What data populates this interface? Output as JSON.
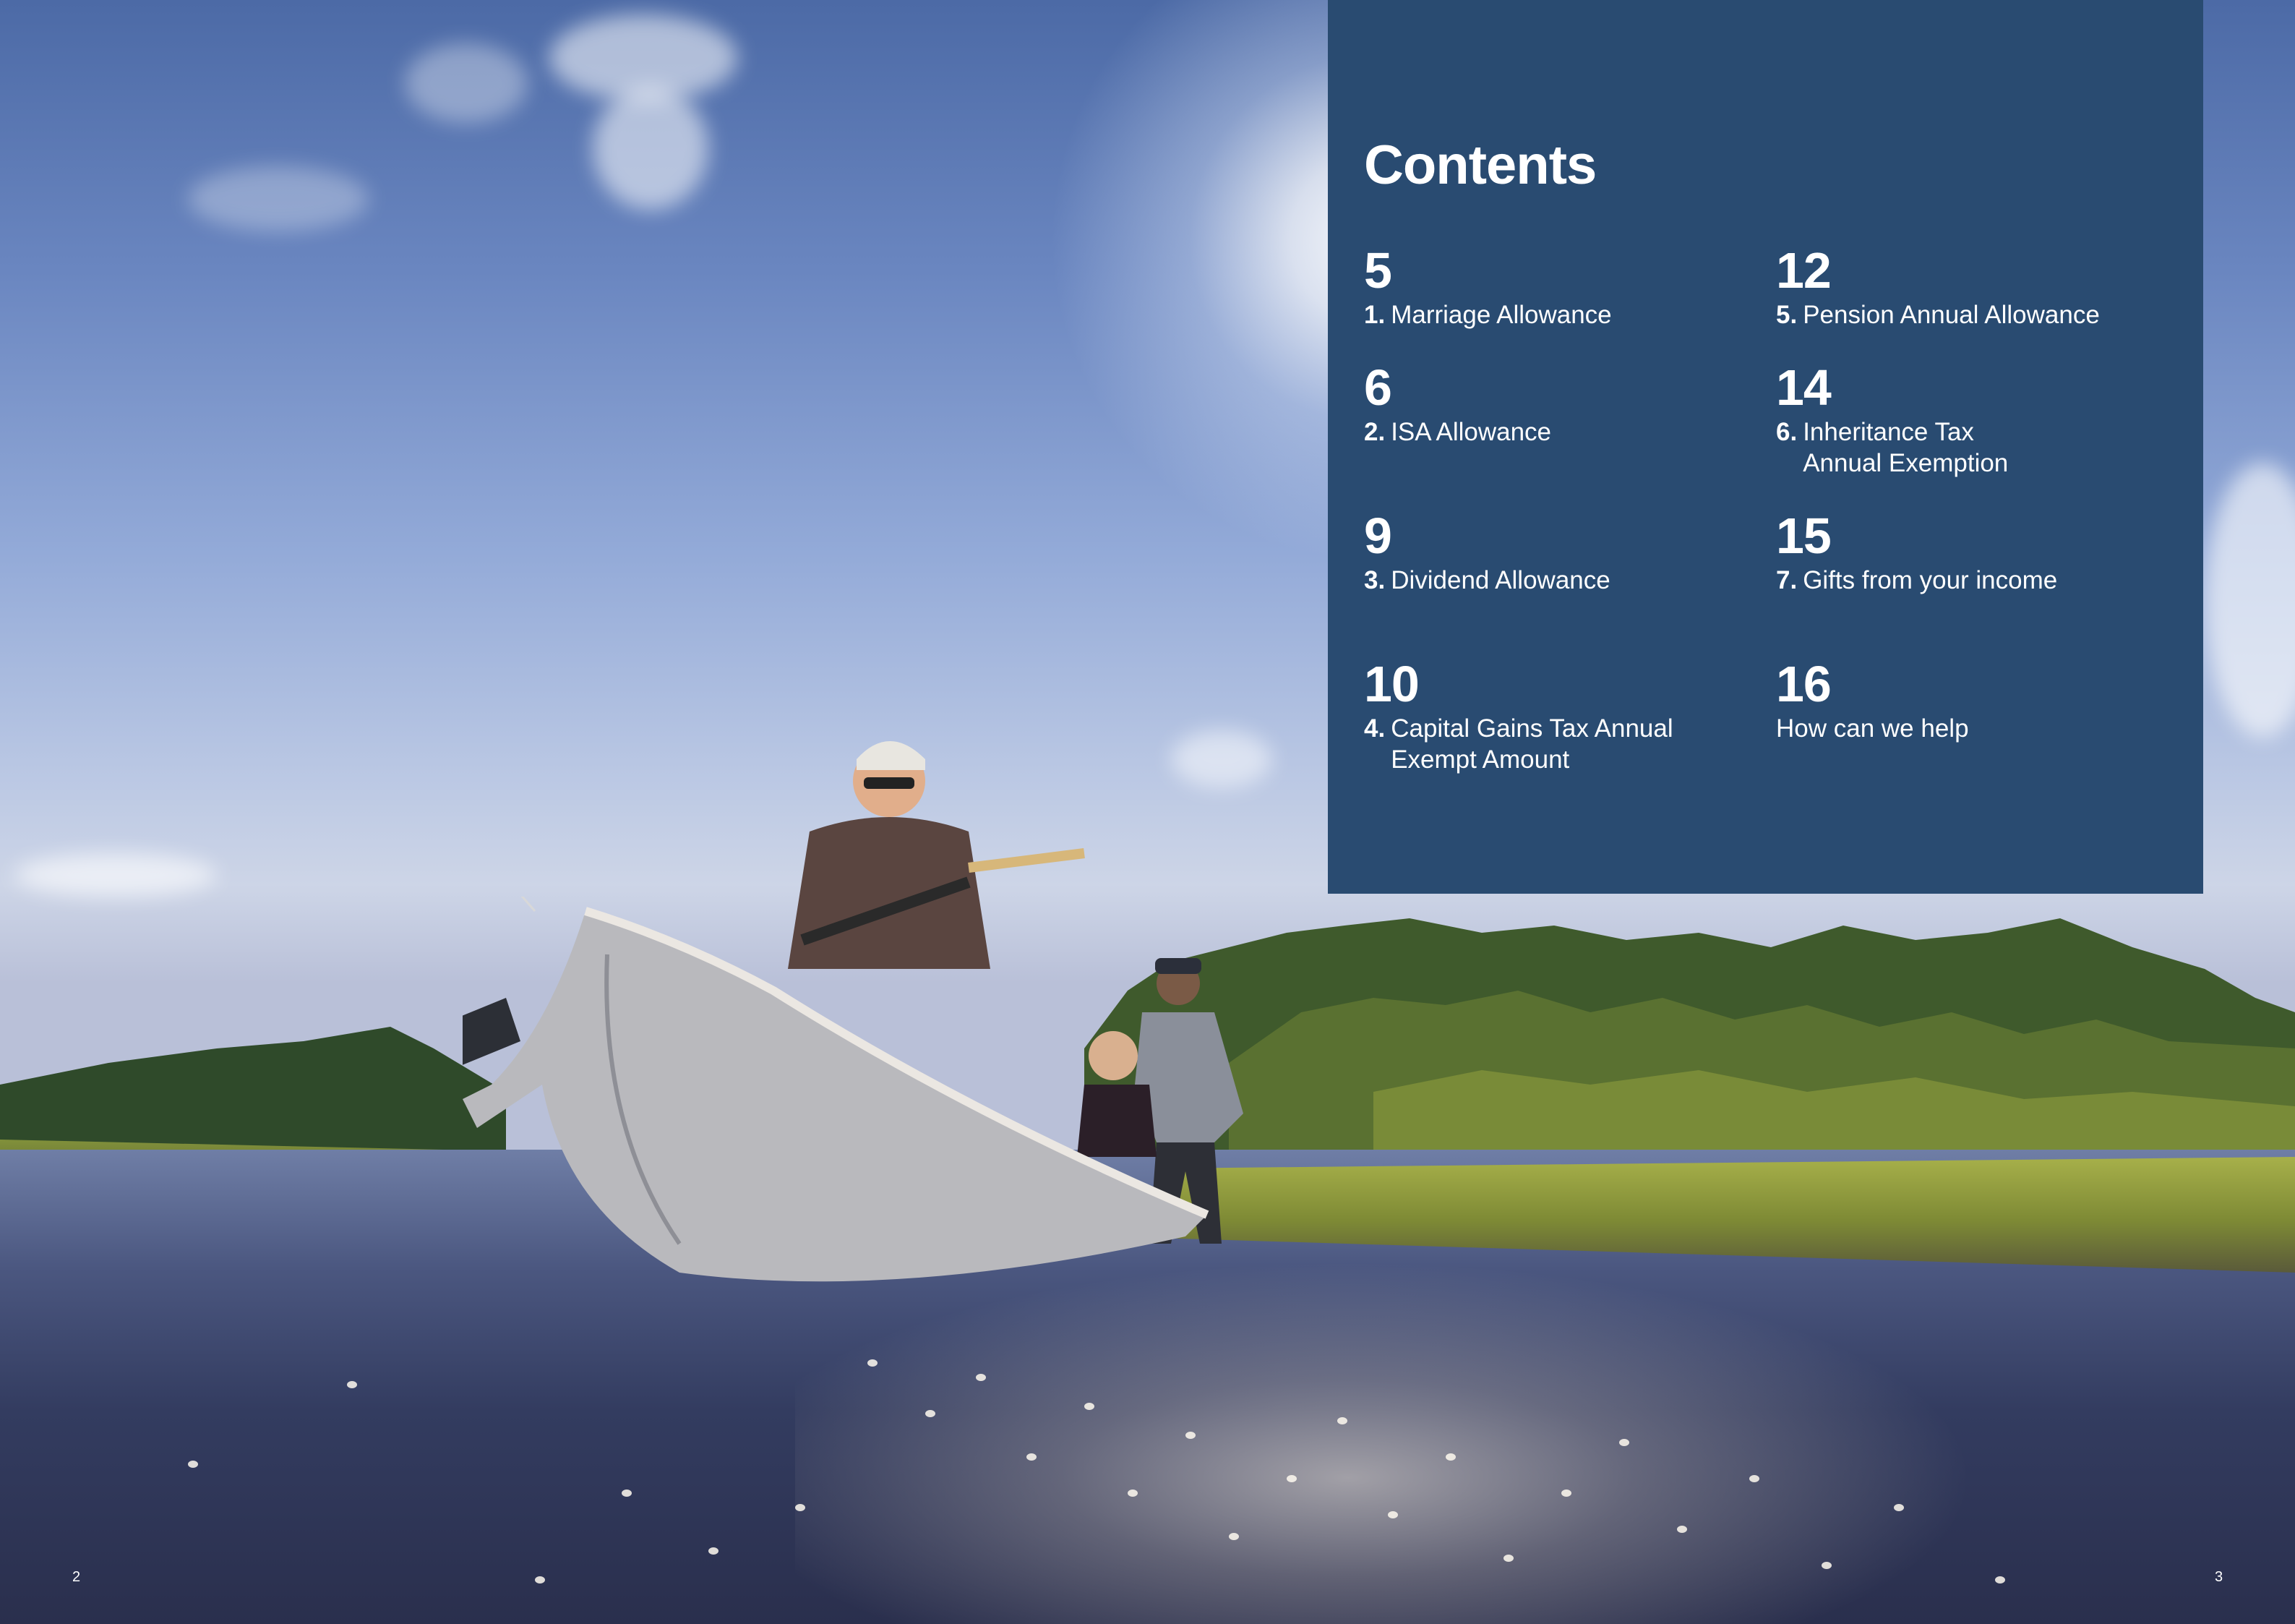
{
  "contents": {
    "title": "Contents",
    "entries": [
      {
        "page": "5",
        "num": "1.",
        "lines": [
          "Marriage Allowance"
        ]
      },
      {
        "page": "6",
        "num": "2.",
        "lines": [
          "ISA Allowance"
        ]
      },
      {
        "page": "9",
        "num": "3.",
        "lines": [
          "Dividend Allowance"
        ]
      },
      {
        "page": "10",
        "num": "4.",
        "lines": [
          "Capital Gains Tax Annual",
          "Exempt Amount"
        ]
      },
      {
        "page": "12",
        "num": "5.",
        "lines": [
          "Pension Annual Allowance"
        ]
      },
      {
        "page": "14",
        "num": "6.",
        "lines": [
          "Inheritance Tax",
          "Annual Exemption"
        ]
      },
      {
        "page": "15",
        "num": "7.",
        "lines": [
          "Gifts from your income"
        ]
      },
      {
        "page": "16",
        "num": "",
        "lines": [
          "How can we help"
        ]
      }
    ]
  },
  "footer": {
    "left_page": "2",
    "right_page": "3"
  },
  "colors": {
    "panel_bg": "#294b71",
    "text": "#ffffff"
  }
}
